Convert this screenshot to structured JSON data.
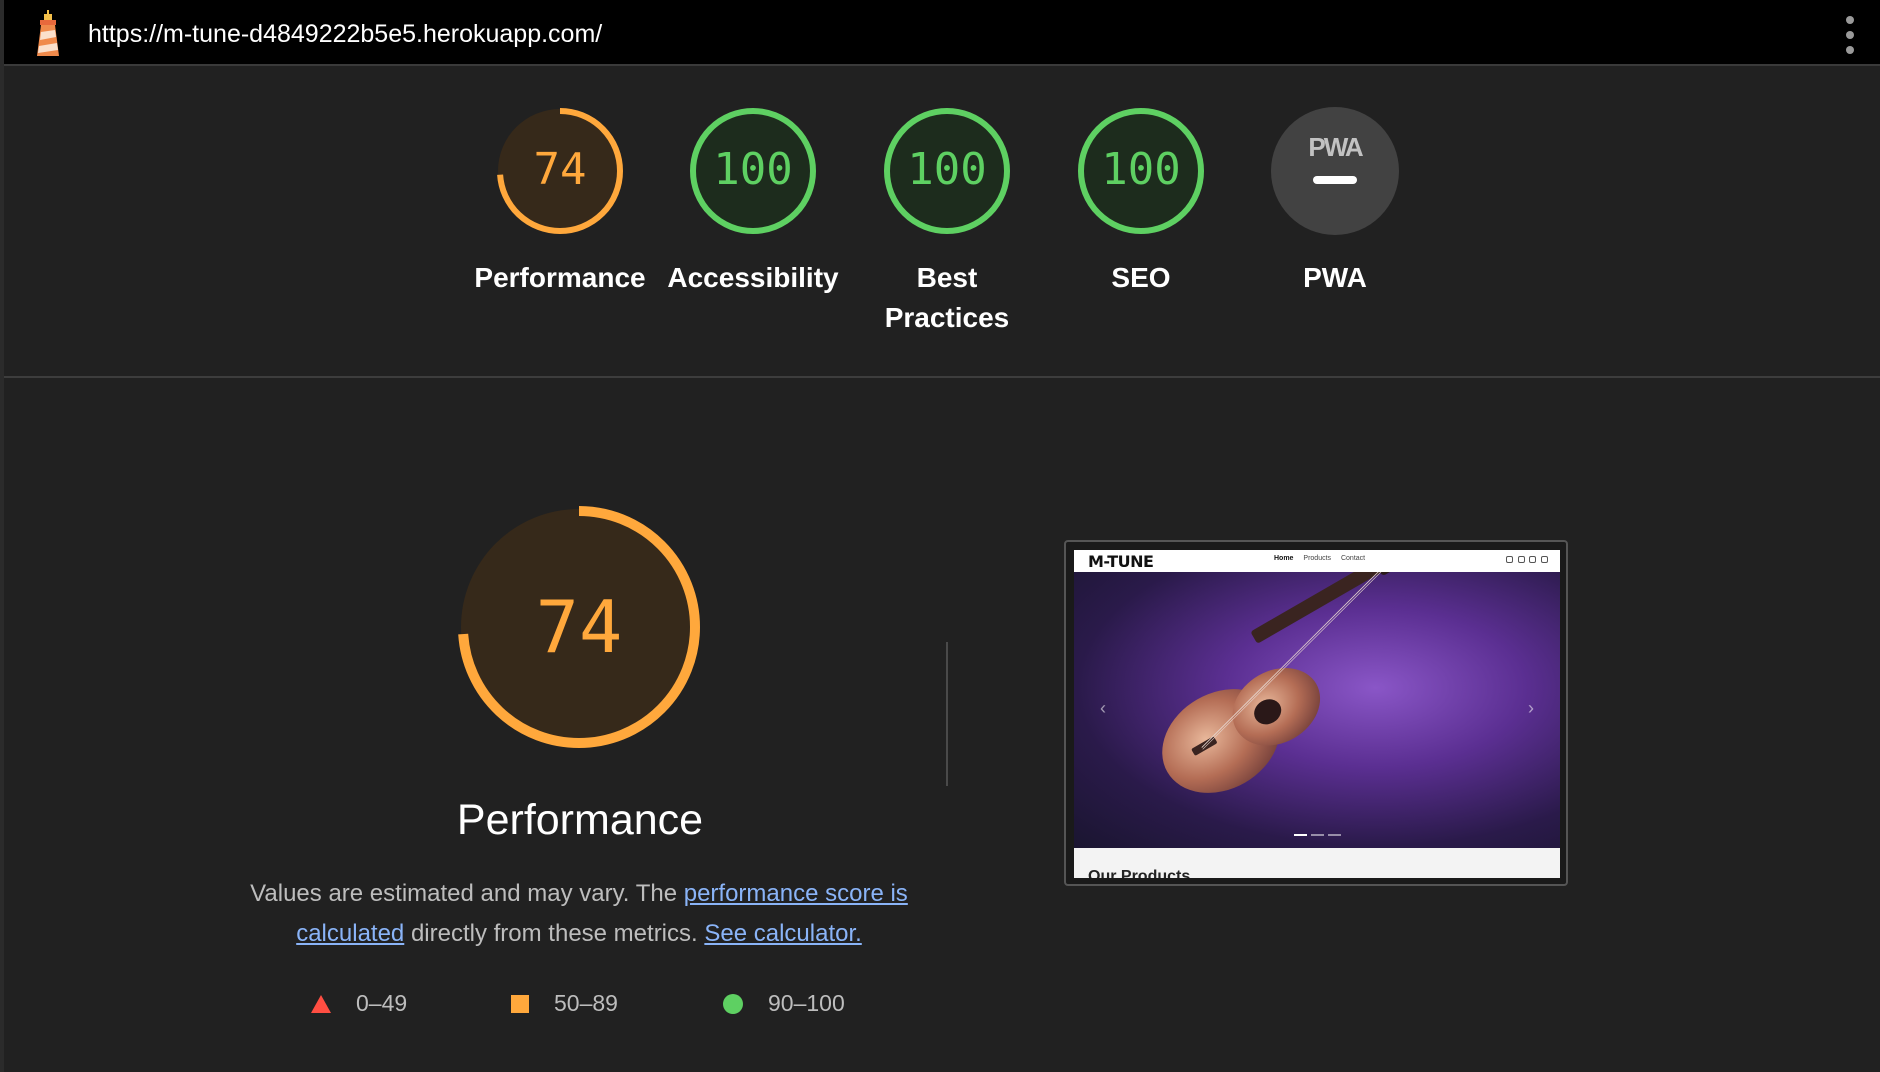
{
  "browser": {
    "url": "https://m-tune-d4849222b5e5.herokuapp.com/"
  },
  "colors": {
    "average": "#ffa83c",
    "pass": "#5ed062",
    "fail": "#ff4e42",
    "neutral": "#c2c2c2",
    "link": "#8ab4f8"
  },
  "categories": [
    {
      "label": "Performance",
      "score": "74",
      "fraction": 0.74,
      "rating": "average"
    },
    {
      "label": "Accessibility",
      "score": "100",
      "fraction": 1.0,
      "rating": "pass"
    },
    {
      "label": "Best Practices",
      "score": "100",
      "fraction": 1.0,
      "rating": "pass"
    },
    {
      "label": "SEO",
      "score": "100",
      "fraction": 1.0,
      "rating": "pass"
    },
    {
      "label": "PWA",
      "score": "",
      "fraction": 0,
      "rating": "neutral",
      "badge": "PWA"
    }
  ],
  "performance": {
    "score": "74",
    "fraction": 0.74,
    "title": "Performance",
    "desc_prefix": "Values are estimated and may vary. The ",
    "desc_link1": "performance score is calculated",
    "desc_middle": " directly from these metrics. ",
    "desc_link2": "See calculator."
  },
  "legend": [
    {
      "range": "0–49",
      "icon": "triangle-icon",
      "rating": "fail"
    },
    {
      "range": "50–89",
      "icon": "square-icon",
      "rating": "average"
    },
    {
      "range": "90–100",
      "icon": "circle-icon",
      "rating": "pass"
    }
  ],
  "screenshot": {
    "brand": "M-TUNE",
    "nav_links": [
      "Home",
      "Products",
      "Contact"
    ],
    "hero_icon": "guitar-image",
    "bottom_text": "Our Products"
  }
}
